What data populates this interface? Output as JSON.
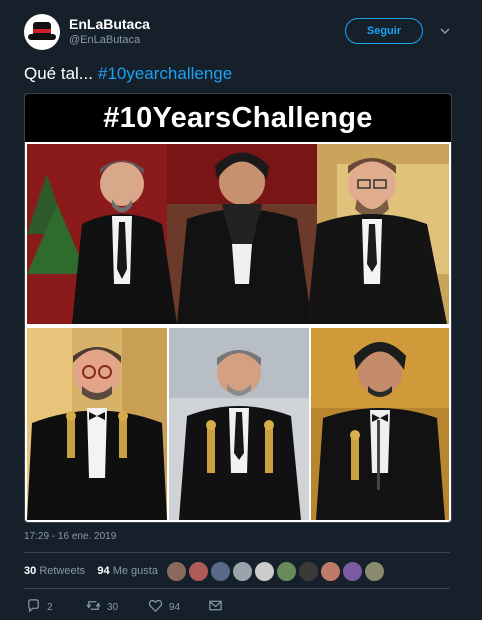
{
  "account": {
    "display_name": "EnLaButaca",
    "handle": "@EnLaButaca",
    "follow_label": "Seguir"
  },
  "tweet": {
    "text": "Qué tal...",
    "hashtag": "#10yearchallenge"
  },
  "media": {
    "banner_text": "#10YearsChallenge"
  },
  "meta": {
    "timestamp": "17:29 - 16 ene. 2019"
  },
  "stats": {
    "retweets_count": "30",
    "retweets_label": "Retweets",
    "likes_count": "94",
    "likes_label": "Me gusta"
  },
  "actions": {
    "reply_count": "2",
    "retweet_count": "30",
    "like_count": "94"
  },
  "colors": {
    "background": "#15202b",
    "accent": "#1da1f2",
    "muted_text": "#8899a6",
    "divider": "#38444d"
  },
  "icons": [
    "chevron-down-icon",
    "reply-icon",
    "retweet-icon",
    "like-icon",
    "message-icon"
  ]
}
